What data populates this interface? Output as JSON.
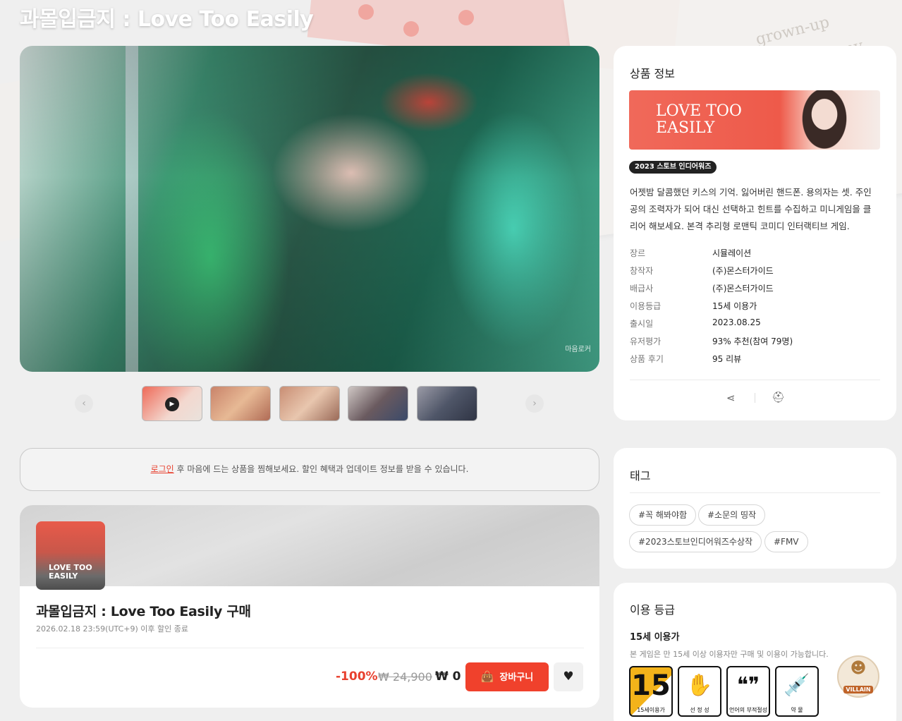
{
  "page": {
    "title": "과몰입금지 : Love Too Easily"
  },
  "media": {
    "watermark": "마음로커"
  },
  "thumbnails": [
    {
      "label": "video-thumbnail"
    },
    {
      "label": "screenshot-2"
    },
    {
      "label": "screenshot-3"
    },
    {
      "label": "screenshot-4"
    },
    {
      "label": "screenshot-5"
    }
  ],
  "notice": {
    "login_link": "로그인",
    "text": " 후 마음에 드는 상품을 찜해보세요. 할인 혜택과 업데이트 정보를 받을 수 있습니다."
  },
  "purchase": {
    "capsule_text_1": "LOVE TOO",
    "capsule_text_2": "EASILY",
    "title": "과몰입금지 : Love Too Easily 구매",
    "sale_end": "2026.02.18 23:59(UTC+9) 이후 할인 종료",
    "discount": "-100%",
    "original_price": "₩ 24,900",
    "final_price": "₩ 0",
    "cart_label": "장바구니"
  },
  "product_info": {
    "heading": "상품 정보",
    "banner_logo_1": "LOVE TOO",
    "banner_logo_2": "EASILY",
    "award": "2023 스토브 인디어워즈",
    "description": "어젯밤 달콤했던 키스의 기억. 잃어버린 핸드폰. 용의자는 셋. 주인공의 조력자가 되어 대신 선택하고 힌트를 수집하고 미니게임을 클리어 해보세요. 본격 추리형 로맨틱 코미디 인터랙티브 게임.",
    "rows": [
      {
        "k": "장르",
        "v": "시뮬레이션"
      },
      {
        "k": "창작자",
        "v": "(주)몬스터가이드"
      },
      {
        "k": "배급사",
        "v": "(주)몬스터가이드"
      },
      {
        "k": "이용등급",
        "v": "15세 이용가"
      },
      {
        "k": "출시일",
        "v": "2023.08.25"
      },
      {
        "k": "유저평가",
        "v": "93% 추천(참여 79명)"
      },
      {
        "k": "상품 후기",
        "v": "95 리뷰"
      }
    ]
  },
  "tags": {
    "heading": "태그",
    "items": [
      "#꼭 해봐야함",
      "#소문의 띵작",
      "#2023스토브인디어워즈수상작",
      "#FMV"
    ]
  },
  "rating": {
    "heading": "이용 등급",
    "age": "15세 이용가",
    "note": "본 게임은 만 15세 이상 이용자만 구매 및 이용이 가능합니다.",
    "badges": [
      {
        "sym": "15",
        "label": "15세이용가"
      },
      {
        "sym": "✋",
        "label": "선 정 성"
      },
      {
        "sym": "❝❞",
        "label": "언어의 부적절성"
      },
      {
        "sym": "💉",
        "label": "약 물"
      }
    ]
  },
  "villain": {
    "label": "VILLAIN"
  }
}
